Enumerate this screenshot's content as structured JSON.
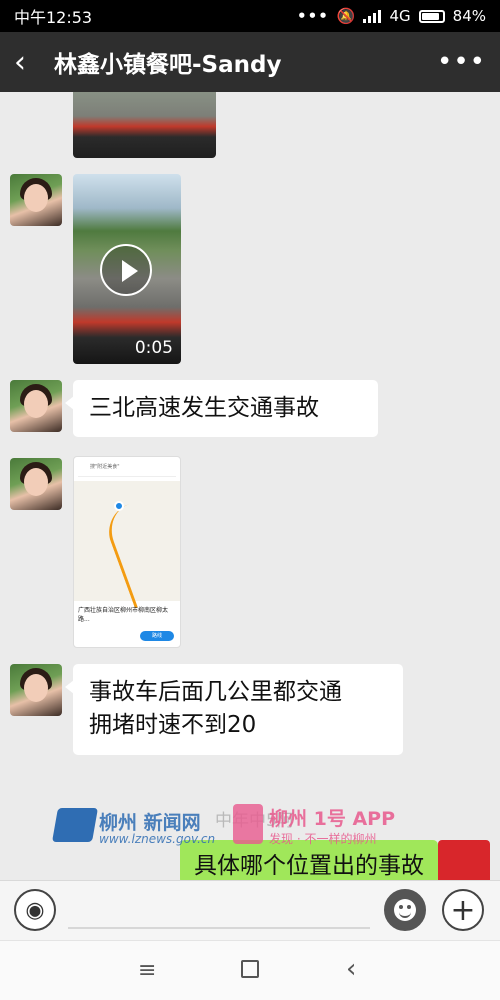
{
  "status_bar": {
    "time": "中午12:53",
    "network": "4G",
    "battery": "84%",
    "icons": [
      "more-dots-icon",
      "mute-icon",
      "signal-icon",
      "battery-icon"
    ]
  },
  "header": {
    "title": "林鑫小镇餐吧-Sandy",
    "back_icon": "back-arrow-icon",
    "more_icon": "more-options-icon"
  },
  "messages": [
    {
      "type": "video",
      "sender": "Sandy",
      "duration": "0:05"
    },
    {
      "type": "text",
      "sender": "Sandy",
      "text": "三北高速发生交通事故"
    },
    {
      "type": "image",
      "sender": "Sandy",
      "content": "map-screenshot",
      "map": {
        "search": "搜\"附近美食\"",
        "address": "广西壮族自治区柳州市柳南区柳太路...",
        "go": "路线"
      }
    },
    {
      "type": "text",
      "sender": "Sandy",
      "lines": [
        "事故车后面几公里都交通",
        "拥堵时速不到20"
      ]
    },
    {
      "type": "text",
      "sender": "me",
      "text": "具体哪个位置出的事故"
    }
  ],
  "watermark": {
    "site_name": "柳州 新闻网",
    "site_url": "www.lznews.gov.cn",
    "app_name": "柳州 1号 APP",
    "app_slogan": "发现 · 不一样的柳州",
    "overlay": "中年中5阿"
  },
  "input_bar": {
    "voice_icon": "voice-icon",
    "emoji_icon": "emoji-icon",
    "plus_icon": "plus-icon",
    "value": ""
  },
  "nav_bar": {
    "menu_glyph": "≡",
    "back_glyph": "‹"
  },
  "colors": {
    "header_bg": "#2e2e2e",
    "chat_bg": "#ebebeb",
    "sent_bubble": "#a0e75a",
    "received_bubble": "#ffffff"
  }
}
